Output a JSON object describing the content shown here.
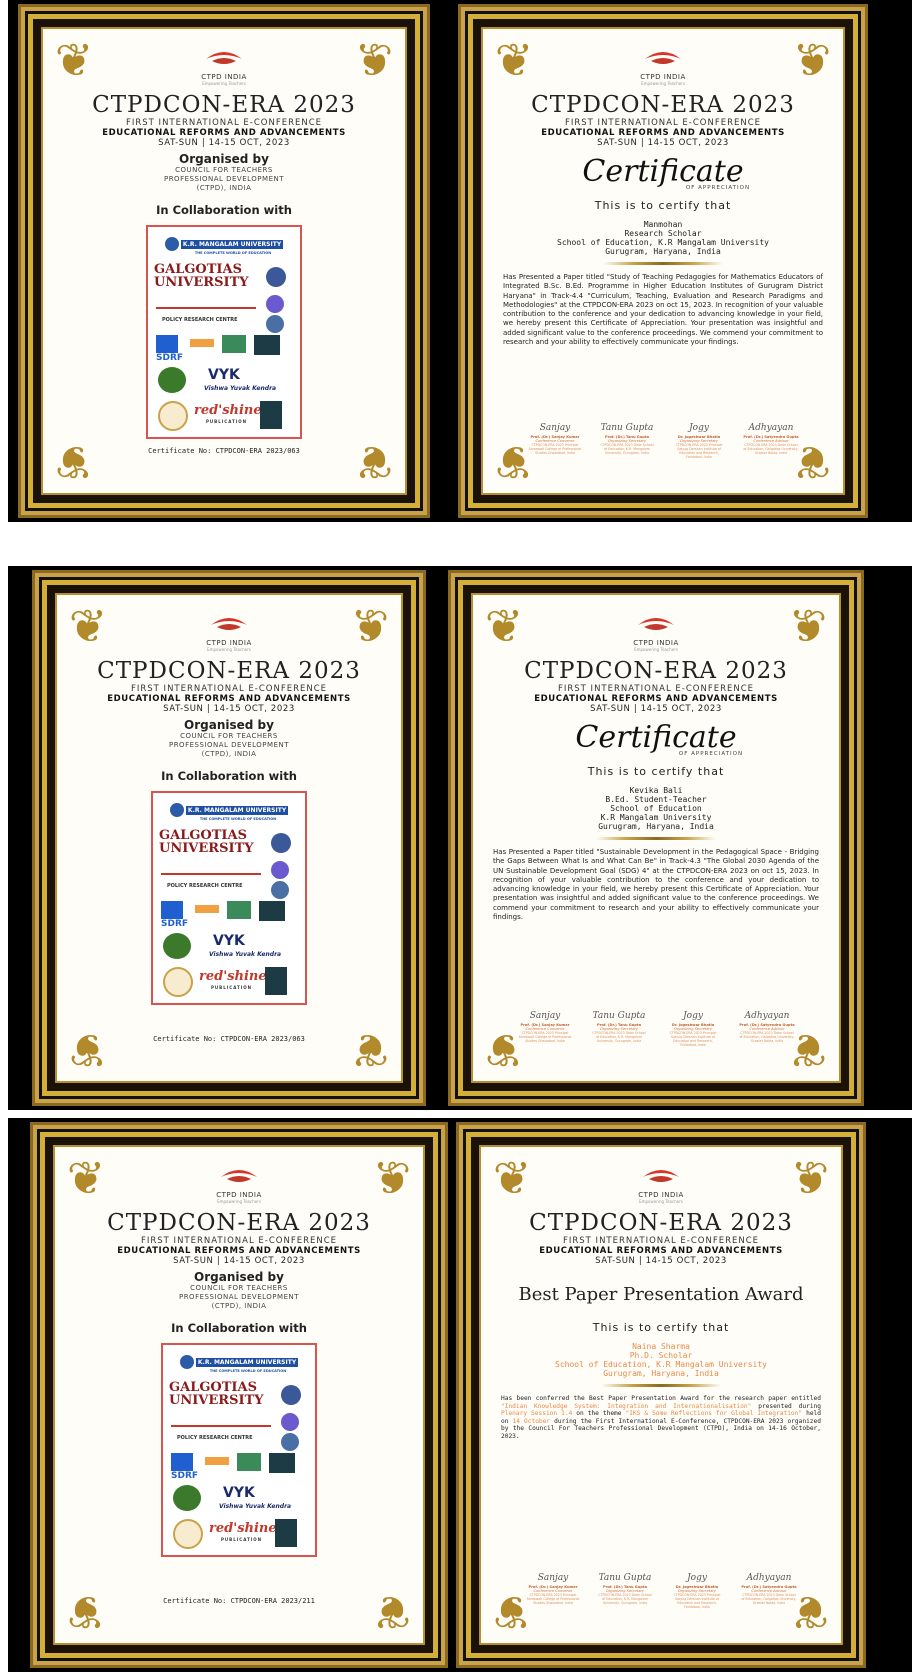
{
  "brand": {
    "name": "CTPD INDIA",
    "tagline": "Empowering Teachers"
  },
  "conference": {
    "name": "CTPDCON-ERA 2023",
    "subtitle": "FIRST INTERNATIONAL E-CONFERENCE",
    "theme": "EDUCATIONAL REFORMS AND ADVANCEMENTS",
    "date": "SAT-SUN | 14-15 OCT, 2023"
  },
  "organised": {
    "heading": "Organised by",
    "line1": "COUNCIL FOR TEACHERS",
    "line2": "PROFESSIONAL DEVELOPMENT",
    "line3": "(CTPD), INDIA"
  },
  "collab_heading": "In Collaboration with",
  "partners": {
    "krm": "K.R. MANGALAM UNIVERSITY",
    "krm_sub": "THE COMPLETE WORLD OF EDUCATION",
    "galgotias": "GALGOTIAS UNIVERSITY",
    "prc": "POLICY RESEARCH CENTRE",
    "sdrf": "SDRF",
    "vyk": "Vishwa Yuvak Kendra",
    "redshine": "red'shine",
    "redshine_sub": "PUBLICATION"
  },
  "covers": [
    {
      "cert_no": "Certificate No: CTPDCON-ERA 2023/063"
    },
    {
      "cert_no": "Certificate No: CTPDCON-ERA 2023/063"
    },
    {
      "cert_no": "Certificate No: CTPDCON-ERA 2023/211"
    }
  ],
  "certificates": [
    {
      "title": "Certificate",
      "title_sub": "OF APPRECIATION",
      "certify": "This is to certify that",
      "recipient": [
        "Manmohan",
        "Research Scholar",
        "School of Education, K.R Mangalam University",
        "Gurugram, Haryana, India"
      ],
      "body": "Has Presented a Paper titled \"Study of Teaching Pedagogies for Mathematics Educators of Integrated B.Sc. B.Ed. Programme in Higher Education Institutes of Gurugram District Haryana\" in Track-4.4 \"Curriculum, Teaching, Evaluation and Research Paradigms and Methodologies\" at the CTPDCON-ERA 2023 on oct 15, 2023. In recognition of your valuable contribution to the conference and your dedication to advancing knowledge in your field, we hereby present this Certificate of Appreciation. Your presentation was insightful and added significant value to the conference proceedings. We commend your commitment to research and your ability to effectively communicate your findings."
    },
    {
      "title": "Certificate",
      "title_sub": "OF APPRECIATION",
      "certify": "This is to certify that",
      "recipient": [
        "Kevika Bali",
        "B.Ed. Student-Teacher",
        "School of Education",
        "K.R Mangalam University",
        "Gurugram, Haryana, India"
      ],
      "body": "Has Presented a Paper titled \"Sustainable Development in the Pedagogical Space - Bridging the Gaps Between What Is and What Can Be\" in Track-4.3 \"The Global 2030 Agenda of the UN Sustainable Development Goal (SDG) 4\" at the CTPDCON-ERA 2023 on oct 15, 2023. In recognition of your valuable contribution to the conference and your dedication to advancing knowledge in your field, we hereby present this Certificate of Appreciation. Your presentation was insightful and added significant value to the conference proceedings. We commend your commitment to research and your ability to effectively communicate your findings."
    },
    {
      "title": "Best Paper Presentation Award",
      "certify": "This is to certify that",
      "recipient": [
        "Naina Sharma",
        "Ph.D. Scholar",
        "School of Education, K.R Mangalam University",
        "Gurugram, Haryana, India"
      ],
      "body_a": "Has been conferred the Best Paper Presentation Award for the research paper entitled ",
      "body_paper": "\"Indian Knowledge System: Integration and Internationalisation\"",
      "body_b": " presented during ",
      "body_session": "Plenary Session 1.4",
      "body_c": " on the theme ",
      "body_theme": "\"IKS & Some Reflections for Global Integration\"",
      "body_d": " held on ",
      "body_held": "14 October",
      "body_e": " during the First International E-Conference, CTPDCON-ERA 2023 organized by the Council For Teachers Professional Development (CTPD), India on 14-16 October, 2023."
    }
  ],
  "signatories": [
    {
      "name": "Prof. (Dr.) Sanjay Kumar",
      "role": "Conference Convenor",
      "org": "CTPDCON-ERA 2023 Principal Saraswati College of Professional Studies Ghaziabad, India",
      "sig": "Sanjay"
    },
    {
      "name": "Prof. (Dr.) Tanu Gupta",
      "role": "Organizing Secretary",
      "org": "CTPDCON-ERA 2023 Dean School of Education, K.R. Mangalam University, Gurugram, India",
      "sig": "Tanu Gupta"
    },
    {
      "name": "Dr. Jogeshwar Bhatia",
      "role": "Organizing Secretary",
      "org": "CTPDCON-ERA 2023 Principal Satyug Darshan Institute of Education and Research, Faridabad, India",
      "sig": "Jogy"
    },
    {
      "name": "Prof. (Dr.) Satyendra Gupta",
      "role": "Conference Advisor",
      "org": "CTPDCON-ERA 2023 Dean School of Education, Galgotias University, Greater Noida, India",
      "sig": "Adhyayan"
    }
  ],
  "colors": {
    "gold": "#d4af37",
    "red": "#d9534f",
    "orange": "#e88a4a",
    "frame": "#000000"
  }
}
